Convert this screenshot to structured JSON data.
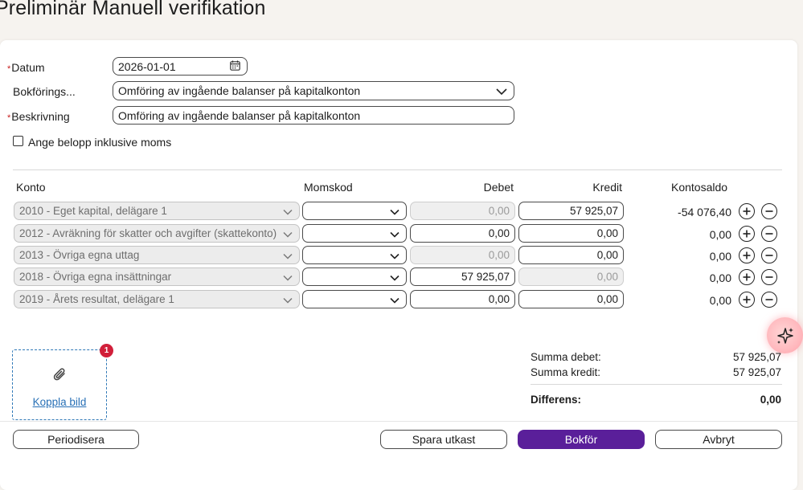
{
  "page": {
    "title": "Preliminär Manuell verifikation"
  },
  "form": {
    "required_mark": "*",
    "datum_label": "Datum",
    "datum_value": "2026-01-01",
    "bokforing_label": "Bokförings...",
    "bokforing_value": "Omföring av ingående balanser på kapitalkonton",
    "beskrivning_label": "Beskrivning",
    "beskrivning_value": "Omföring av ingående balanser på kapitalkonton",
    "moms_checkbox_label": "Ange belopp inklusive moms",
    "moms_checkbox_checked": false
  },
  "table": {
    "headers": {
      "konto": "Konto",
      "momskod": "Momskod",
      "debet": "Debet",
      "kredit": "Kredit",
      "kontosaldo": "Kontosaldo"
    },
    "rows": [
      {
        "konto": "2010 - Eget kapital, delägare 1",
        "momskod": "",
        "debet": "0,00",
        "debet_enabled": false,
        "kredit": "57 925,07",
        "kredit_enabled": true,
        "saldo": "-54 076,40"
      },
      {
        "konto": "2012 - Avräkning för skatter och avgifter (skattekonto)",
        "momskod": "",
        "debet": "0,00",
        "debet_enabled": true,
        "kredit": "0,00",
        "kredit_enabled": true,
        "saldo": "0,00"
      },
      {
        "konto": "2013 - Övriga egna uttag",
        "momskod": "",
        "debet": "0,00",
        "debet_enabled": false,
        "kredit": "0,00",
        "kredit_enabled": true,
        "saldo": "0,00"
      },
      {
        "konto": "2018 - Övriga egna insättningar",
        "momskod": "",
        "debet": "57 925,07",
        "debet_enabled": true,
        "kredit": "0,00",
        "kredit_enabled": false,
        "saldo": "0,00"
      },
      {
        "konto": "2019 - Årets resultat, delägare 1",
        "momskod": "",
        "debet": "0,00",
        "debet_enabled": true,
        "kredit": "0,00",
        "kredit_enabled": true,
        "saldo": "0,00"
      }
    ]
  },
  "attachment": {
    "link_label": "Koppla bild",
    "badge_count": "1",
    "icon": "paperclip-icon"
  },
  "summary": {
    "debet_label": "Summa debet:",
    "debet_value": "57 925,07",
    "kredit_label": "Summa kredit:",
    "kredit_value": "57 925,07",
    "diff_label": "Differens:",
    "diff_value": "0,00"
  },
  "actions": {
    "periodisera": "Periodisera",
    "spara": "Spara utkast",
    "bokfor": "Bokför",
    "avbryt": "Avbryt"
  },
  "colors": {
    "primary": "#5a1f9a",
    "link": "#2870b6",
    "required": "#c81e1e",
    "badge": "#d11f3a",
    "ai_button": "#ffb9be"
  }
}
